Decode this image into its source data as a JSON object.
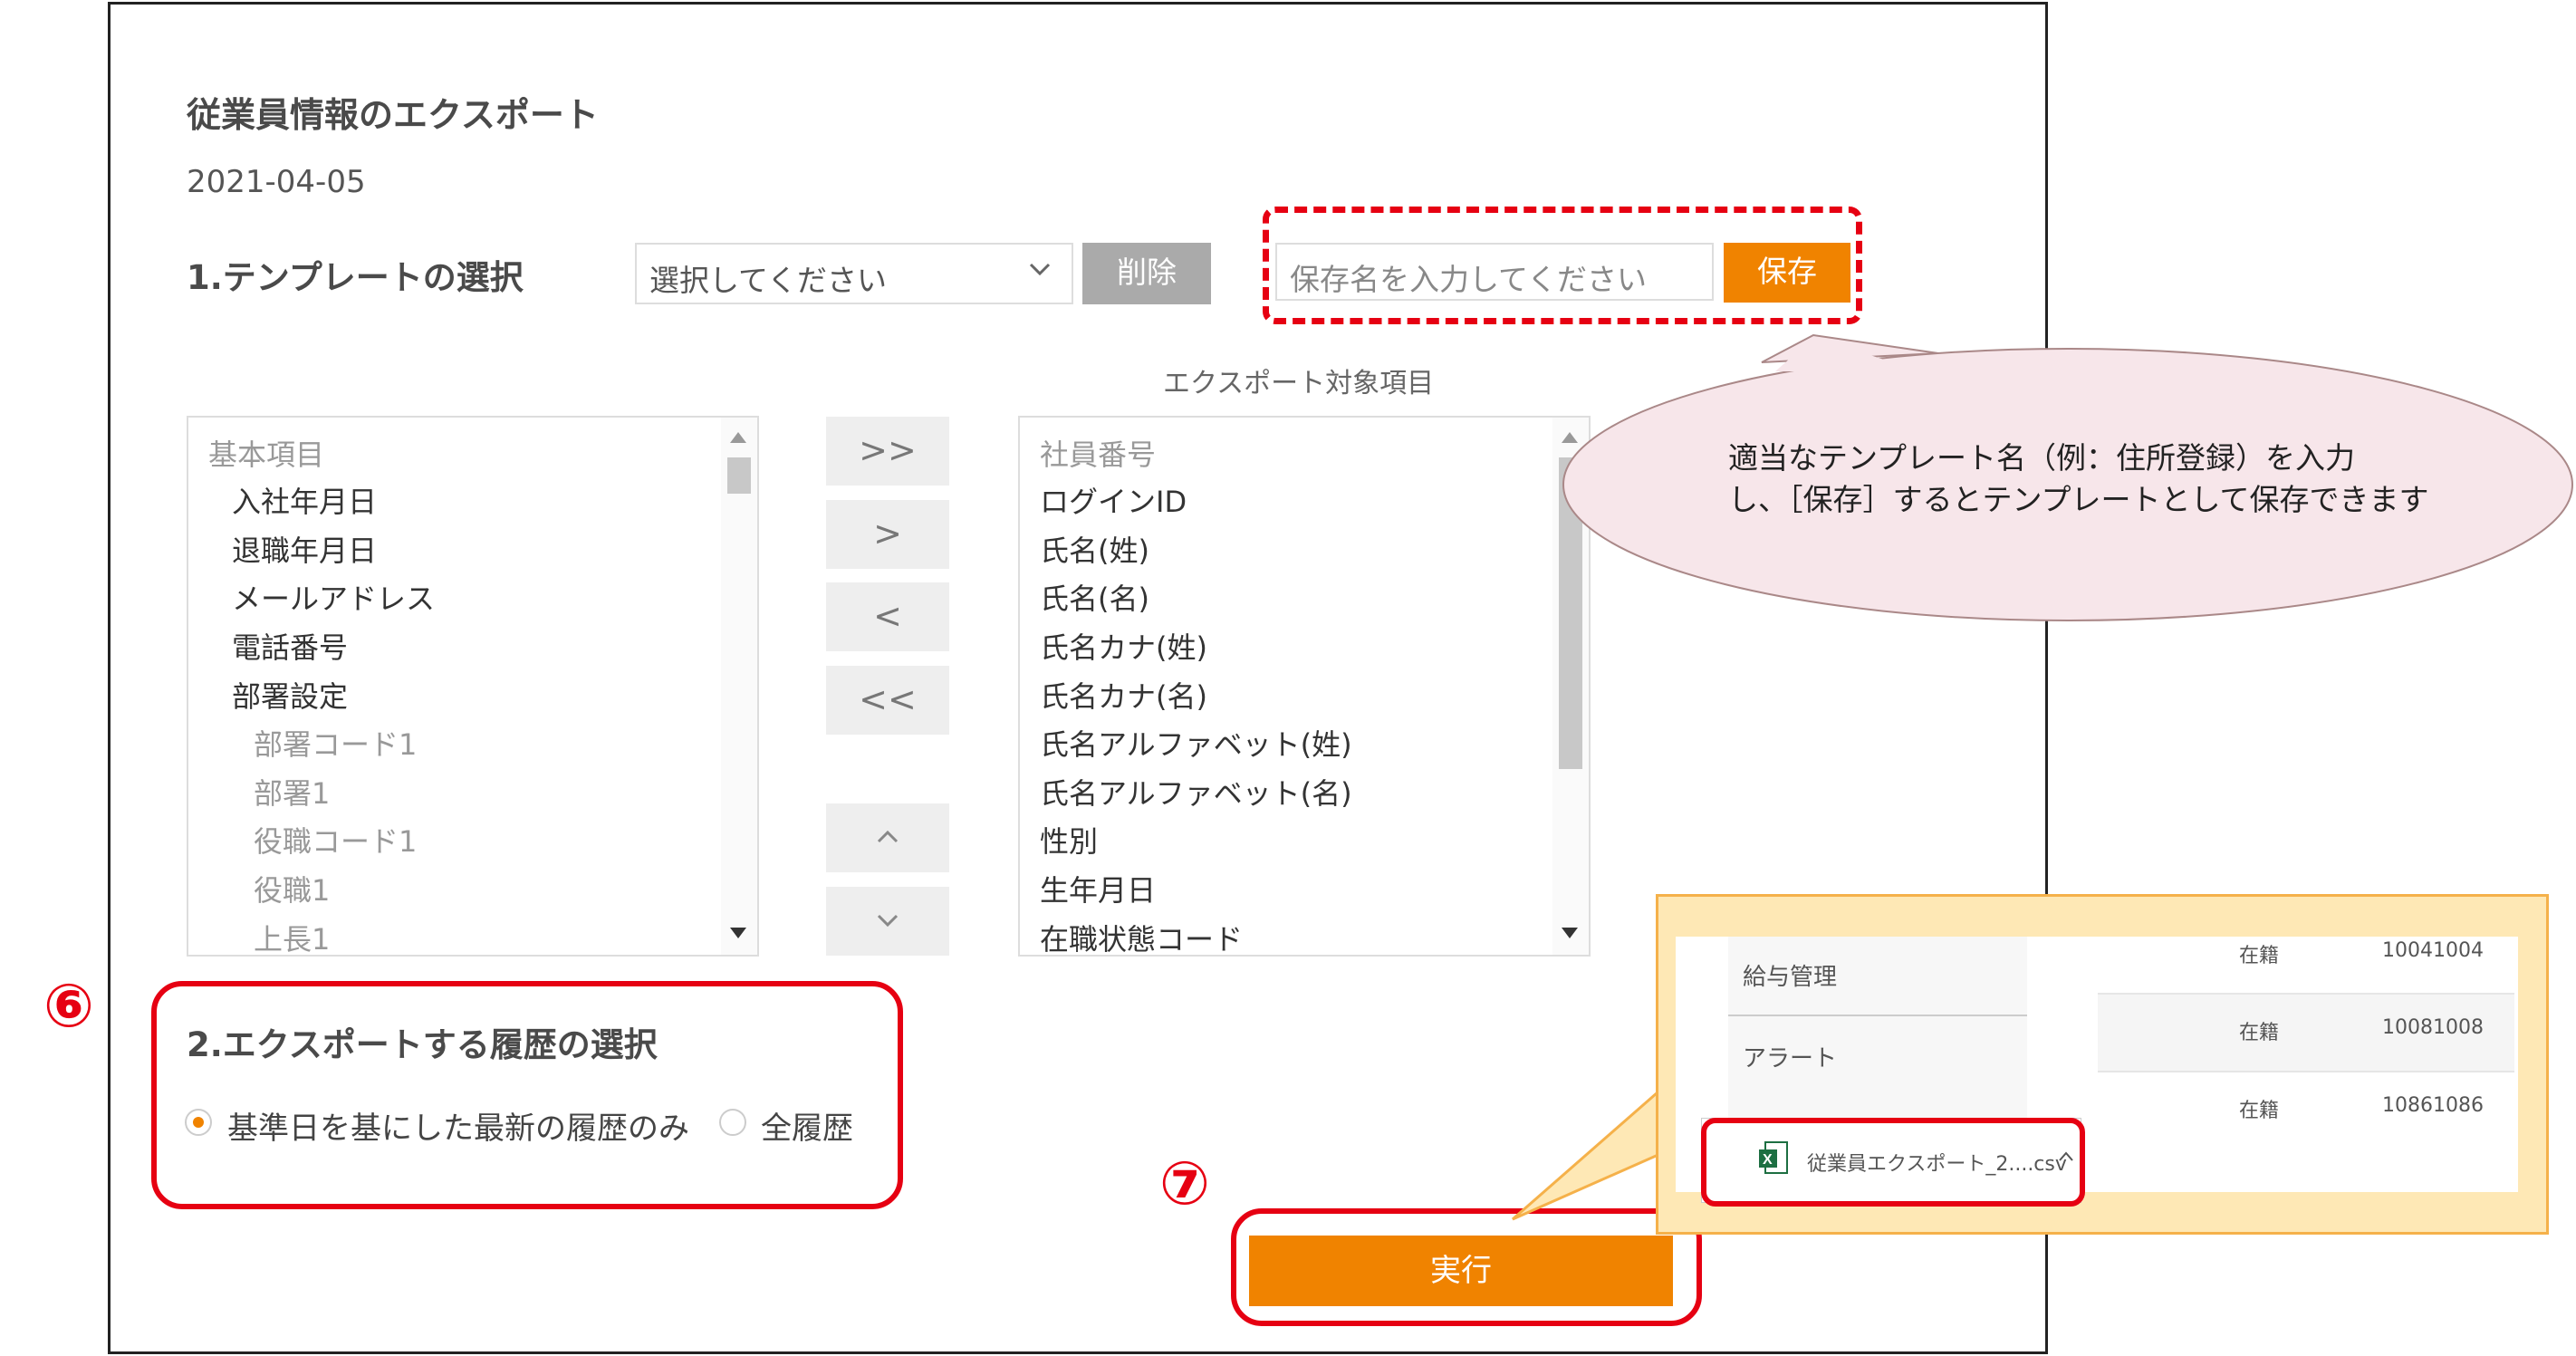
{
  "header": {
    "title": "従業員情報のエクスポート",
    "date": "2021-04-05"
  },
  "template_section": {
    "heading": "1.テンプレートの選択",
    "select_placeholder": "選択してください",
    "delete_label": "削除",
    "save_name_placeholder": "保存名を入力してください",
    "save_label": "保存"
  },
  "export_list_title": "エクスポート対象項目",
  "left_list": {
    "items": [
      {
        "label": "基本項目",
        "style": "grey"
      },
      {
        "label": "入社年月日",
        "style": "normal"
      },
      {
        "label": "退職年月日",
        "style": "normal"
      },
      {
        "label": "メールアドレス",
        "style": "normal"
      },
      {
        "label": "電話番号",
        "style": "normal"
      },
      {
        "label": "部署設定",
        "style": "normal"
      },
      {
        "label": "部署コード1",
        "style": "grey"
      },
      {
        "label": "部署1",
        "style": "grey"
      },
      {
        "label": "役職コード1",
        "style": "grey"
      },
      {
        "label": "役職1",
        "style": "grey"
      },
      {
        "label": "上長1",
        "style": "grey"
      }
    ]
  },
  "right_list": {
    "items": [
      {
        "label": "社員番号",
        "style": "grey"
      },
      {
        "label": "ログインID",
        "style": "normal"
      },
      {
        "label": "氏名(姓)",
        "style": "normal"
      },
      {
        "label": "氏名(名)",
        "style": "normal"
      },
      {
        "label": "氏名カナ(姓)",
        "style": "normal"
      },
      {
        "label": "氏名カナ(名)",
        "style": "normal"
      },
      {
        "label": "氏名アルファベット(姓)",
        "style": "normal"
      },
      {
        "label": "氏名アルファベット(名)",
        "style": "normal"
      },
      {
        "label": "性別",
        "style": "normal"
      },
      {
        "label": "生年月日",
        "style": "normal"
      },
      {
        "label": "在職状態コード",
        "style": "normal"
      }
    ]
  },
  "move_buttons": {
    "add_all": ">>",
    "add": ">",
    "remove": "<",
    "remove_all": "<<",
    "up": "^",
    "down": "v"
  },
  "history_section": {
    "heading": "2.エクスポートする履歴の選択",
    "option_latest": "基準日を基にした最新の履歴のみ",
    "option_all": "全履歴",
    "selected": "latest"
  },
  "execute_label": "実行",
  "annotations": {
    "step6": "⑥",
    "step7": "⑦",
    "callout_line1": "適当なテンプレート名（例：住所登録）を入力",
    "callout_line2": "し、［保存］するとテンプレートとして保存できます"
  },
  "download_popup": {
    "menu_items": [
      "給与管理",
      "アラート"
    ],
    "rows": [
      {
        "status": "在籍",
        "id": "10041004"
      },
      {
        "status": "在籍",
        "id": "10081008"
      },
      {
        "status": "在籍",
        "id": "10861086"
      }
    ],
    "file_name": "従業員エクスポート_2....csv"
  },
  "colors": {
    "accent": "#f08300",
    "annotation_red": "#e60012",
    "callout_fill": "#f7e6ea",
    "popup_fill": "#fee8b5"
  }
}
